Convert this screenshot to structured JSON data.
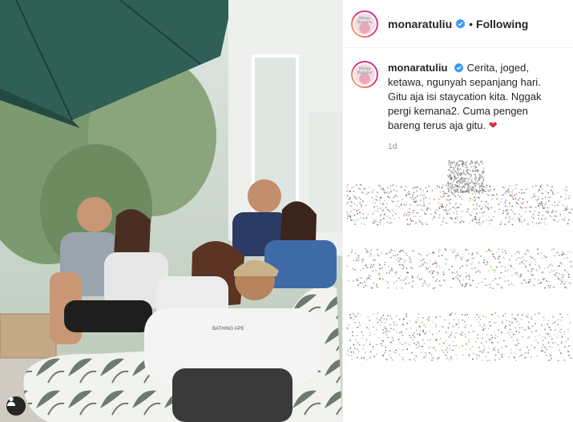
{
  "post": {
    "username": "monaratuliu",
    "follow_state": "Following",
    "dot": "•",
    "caption": "Cerita, joged, ketawa, ngunyah sepanjang hari. Gitu aja isi staycation kita. Nggak pergi kemana2. Cuma pengen bareng terus aja gitu.",
    "caption_emoji": "❤",
    "age": "1d"
  },
  "avatar_text": "Mona Ratuliu",
  "photo_sweatshirt_text": "BATHING APE",
  "colors": {
    "verified": "#3897f0",
    "heart": "#d93348",
    "roof": "#2f5f56"
  },
  "icons": {
    "tag": "person-tag-icon",
    "verified": "verified-badge-icon"
  }
}
